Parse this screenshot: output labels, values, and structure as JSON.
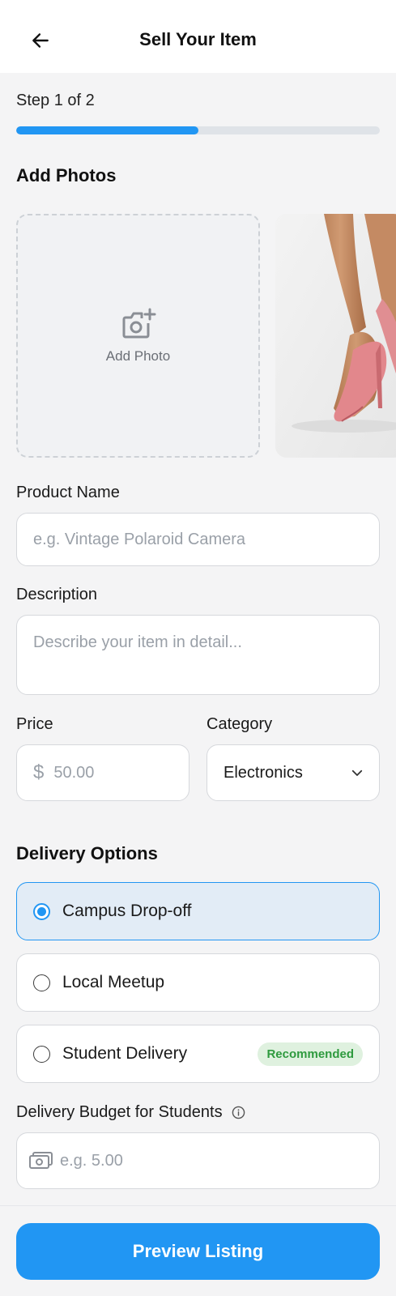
{
  "header": {
    "title": "Sell Your Item",
    "back_icon": "arrow-left-icon"
  },
  "progress": {
    "step_text": "Step 1 of 2",
    "fraction": 0.5,
    "color": "#2196f3"
  },
  "photos": {
    "title": "Add Photos",
    "add_label": "Add Photo",
    "add_icon": "camera-plus-icon",
    "thumbnail": "pink-heels-photo"
  },
  "product_name": {
    "label": "Product Name",
    "placeholder": "e.g. Vintage Polaroid Camera"
  },
  "description": {
    "label": "Description",
    "placeholder": "Describe your item in detail..."
  },
  "price": {
    "label": "Price",
    "symbol": "$",
    "placeholder": "50.00"
  },
  "category": {
    "label": "Category",
    "value": "Electronics"
  },
  "delivery": {
    "title": "Delivery Options",
    "options": [
      {
        "label": "Campus Drop-off",
        "selected": true
      },
      {
        "label": "Local Meetup",
        "selected": false
      },
      {
        "label": "Student Delivery",
        "selected": false,
        "badge": "Recommended"
      }
    ]
  },
  "budget": {
    "label": "Delivery Budget for Students",
    "placeholder": "e.g. 5.00",
    "icon": "cash-icon"
  },
  "cta": {
    "label": "Preview Listing"
  },
  "colors": {
    "accent": "#2196f3",
    "badge_bg": "#dff1df",
    "badge_text": "#2e9a3e"
  }
}
